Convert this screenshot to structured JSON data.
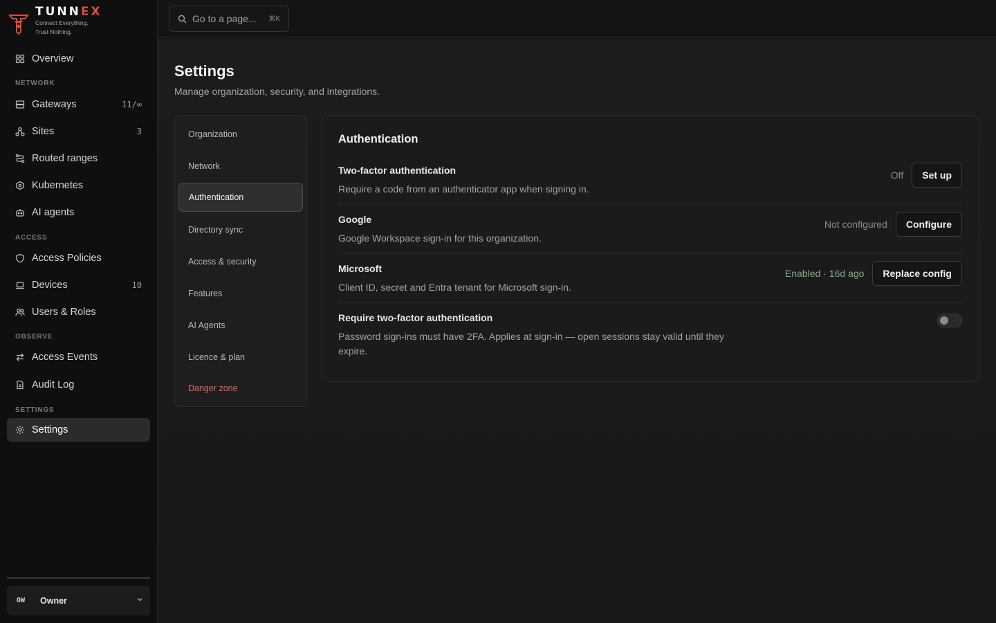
{
  "brand": {
    "name_main": "TUNN",
    "name_accent": "EX",
    "tagline_1": "Connect Everything.",
    "tagline_2": "Trust Nothing."
  },
  "search": {
    "placeholder": "Go to a page...",
    "shortcut": "⌘K"
  },
  "sidebar": {
    "overview": {
      "label": "Overview",
      "icon": "grid-icon"
    },
    "sections": {
      "network": "NETWORK",
      "access": "ACCESS",
      "observe": "OBSERVE",
      "settings": "SETTINGS"
    },
    "items": {
      "gateways": {
        "label": "Gateways",
        "count": "11/∞",
        "icon": "server-icon"
      },
      "sites": {
        "label": "Sites",
        "count": "3",
        "icon": "sites-icon"
      },
      "routed_ranges": {
        "label": "Routed ranges",
        "icon": "route-icon"
      },
      "kubernetes": {
        "label": "Kubernetes",
        "icon": "kubernetes-icon"
      },
      "ai_agents": {
        "label": "AI agents",
        "icon": "bot-icon"
      },
      "access_policies": {
        "label": "Access Policies",
        "icon": "shield-icon"
      },
      "devices": {
        "label": "Devices",
        "count": "10",
        "icon": "laptop-icon"
      },
      "users_roles": {
        "label": "Users & Roles",
        "icon": "users-icon"
      },
      "access_events": {
        "label": "Access Events",
        "icon": "arrows-icon"
      },
      "audit_log": {
        "label": "Audit Log",
        "icon": "document-icon"
      },
      "settings": {
        "label": "Settings",
        "icon": "gear-icon"
      }
    },
    "user": {
      "initials": "OW",
      "name": "Owner"
    }
  },
  "page": {
    "title": "Settings",
    "subtitle": "Manage organization, security, and integrations."
  },
  "settings_nav": {
    "items": [
      "Organization",
      "Network",
      "Authentication",
      "Directory sync",
      "Access & security",
      "Features",
      "AI Agents",
      "Licence & plan",
      "Danger zone"
    ],
    "active": "Authentication"
  },
  "auth_panel": {
    "title": "Authentication",
    "rows": [
      {
        "title": "Two-factor authentication",
        "desc": "Require a code from an authenticator app when signing in.",
        "status": "Off",
        "button": "Set up"
      },
      {
        "title": "Google",
        "desc": "Google Workspace sign-in for this organization.",
        "status": "Not configured",
        "button": "Configure"
      },
      {
        "title": "Microsoft",
        "desc": "Client ID, secret and Entra tenant for Microsoft sign-in.",
        "status": "Enabled · 16d ago",
        "button": "Replace config"
      },
      {
        "title": "Require two-factor authentication",
        "desc": "Password sign-ins must have 2FA. Applies at sign-in — open sessions stay valid until they expire.",
        "toggle_on": false
      }
    ]
  },
  "colors": {
    "accent": "#e0483d",
    "enabled_status": "#7fae84",
    "danger": "#e06a63"
  }
}
